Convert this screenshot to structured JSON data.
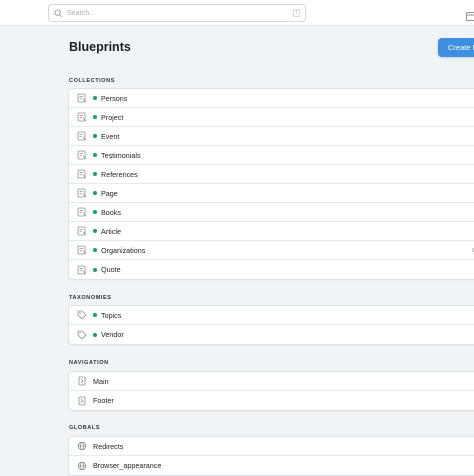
{
  "search": {
    "placeholder": "Search...",
    "shortcut": "/"
  },
  "header": {
    "title": "Blueprints",
    "create_label": "Create Blueprint"
  },
  "colors": {
    "accent": "#3c8fe0",
    "status_dot": "#14a16c"
  },
  "sections": {
    "collections": {
      "title": "COLLECTIONS",
      "items": [
        "Persons",
        "Project",
        "Event",
        "Testimonials",
        "References",
        "Page",
        "Books",
        "Article",
        "Organizations",
        "Quote"
      ]
    },
    "taxonomies": {
      "title": "TAXONOMIES",
      "items": [
        "Topics",
        "Vendor"
      ]
    },
    "navigation": {
      "title": "NAVIGATION",
      "items": [
        "Main",
        "Footer"
      ]
    },
    "globals": {
      "title": "GLOBALS",
      "items": [
        "Redirects",
        "Browser_appearance"
      ]
    }
  }
}
